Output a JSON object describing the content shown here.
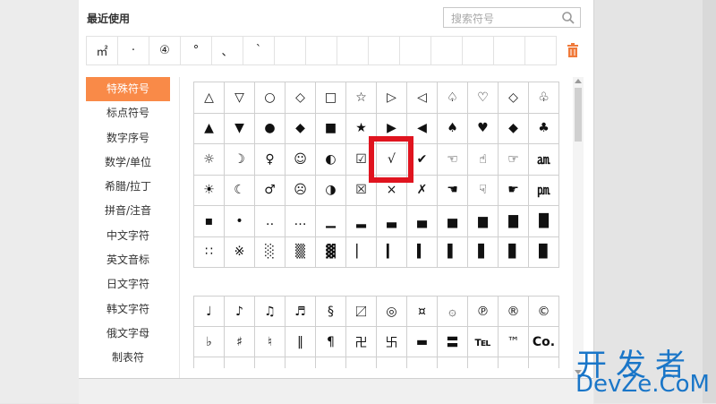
{
  "header": {
    "title": "最近使用",
    "search_placeholder": "搜索符号"
  },
  "recent": [
    "㎡",
    "·",
    "④",
    "°",
    "、",
    "`",
    "",
    "",
    "",
    "",
    "",
    "",
    "",
    "",
    ""
  ],
  "sidebar": {
    "items": [
      "特殊符号",
      "标点符号",
      "数字序号",
      "数学/单位",
      "希腊/拉丁",
      "拼音/注音",
      "中文字符",
      "英文音标",
      "日文字符",
      "韩文字符",
      "俄文字母",
      "制表符"
    ]
  },
  "grid1": [
    "△",
    "▽",
    "○",
    "◇",
    "□",
    "☆",
    "▷",
    "◁",
    "♤",
    "♡",
    "◇",
    "♧",
    "▲",
    "▼",
    "●",
    "◆",
    "■",
    "★",
    "▶",
    "◀",
    "♠",
    "♥",
    "◆",
    "♣",
    "☼",
    "☽",
    "♀",
    "☺",
    "◐",
    "☑",
    "√",
    "✔",
    "☜",
    "☝",
    "☞",
    "㏂",
    "☀",
    "☾",
    "♂",
    "☹",
    "◑",
    "☒",
    "×",
    "✗",
    "☚",
    "☟",
    "☛",
    "㏘",
    "▪",
    "•",
    "‥",
    "…",
    "▁",
    "▂",
    "▃",
    "▄",
    "▅",
    "▆",
    "▇",
    "█",
    "∷",
    "※",
    "░",
    "▒",
    "▓",
    "▏",
    "▎",
    "▍",
    "▌",
    "▋",
    "▊",
    "▉"
  ],
  "grid2": [
    "♩",
    "♪",
    "♫",
    "♬",
    "§",
    "〼",
    "◎",
    "¤",
    "۞",
    "℗",
    "®",
    "©",
    "♭",
    "♯",
    "♮",
    "‖",
    "¶",
    "卍",
    "卐",
    "▬",
    "〓",
    "℡",
    "™",
    "Co.",
    "",
    "",
    "",
    "",
    "",
    "",
    "",
    "",
    "",
    "",
    "",
    ""
  ],
  "colors": {
    "accent": "#f98a48",
    "highlight": "#e0141f",
    "trash": "#f07a3a",
    "watermark": "#1a76c8"
  },
  "watermark": {
    "line1": "开发者",
    "line2": "DevZe.CoM"
  }
}
